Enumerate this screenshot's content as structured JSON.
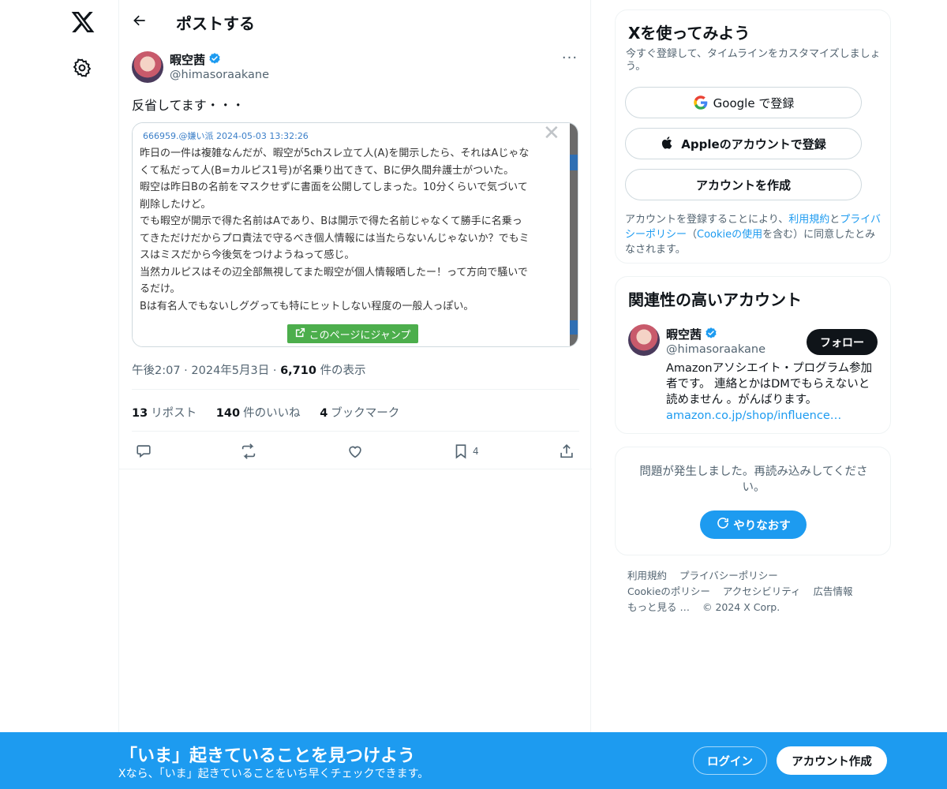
{
  "header": {
    "title": "ポストする"
  },
  "post": {
    "author_name": "暇空茜",
    "author_handle": "@himasoraakane",
    "text": "反省してます・・・",
    "embed": {
      "meta": "666959.@嫌い派 2024-05-03 13:32:26",
      "close_glyph": "✕",
      "lines": [
        "昨日の一件は複雑なんだが、暇空が5chスレ立て人(A)を開示したら、それはAじゃな",
        "くて私だって人(B=カルピス1号)が名乗り出てきて、Bに伊久間弁護士がついた。",
        "暇空は昨日Bの名前をマスクせずに書面を公開してしまった。10分くらいで気づいて",
        "削除したけど。",
        "でも暇空が開示で得た名前はAであり、Bは開示で得た名前じゃなくて勝手に名乗っ",
        "てきただけだからプロ責法で守るべき個人情報には当たらないんじゃないか？でもミ",
        "スはミスだから今後気をつけようねって感じ。",
        "当然カルピスはその辺全部無視してまた暇空が個人情報晒したー！って方向で騒いで",
        "るだけ。",
        "Bは有名人でもないしググっても特にヒットしない程度の一般人っぽい。"
      ],
      "jump_label": "このページにジャンプ"
    },
    "time": "午後2:07",
    "date": "2024年5月3日",
    "separator": "·",
    "views": "6,710",
    "views_label": "件の表示",
    "reposts": "13",
    "reposts_label": "リポスト",
    "likes": "140",
    "likes_label": "件のいいね",
    "bookmarks": "4",
    "bookmarks_label": "ブックマーク",
    "bookmark_action_count": "4"
  },
  "signup": {
    "title": "Xを使ってみよう",
    "desc": "今すぐ登録して、タイムラインをカスタマイズしましょう。",
    "google_label": "Google で登録",
    "apple_label": "Appleのアカウントで登録",
    "create_label": "アカウントを作成",
    "terms_prefix": "アカウントを登録することにより、",
    "terms_link1": "利用規約",
    "terms_and": "と",
    "terms_link2": "プライバシーポリシー",
    "terms_paren_open": "（",
    "terms_link3": "Cookieの使用",
    "terms_suffix": "を含む）に同意したとみなされます。"
  },
  "related": {
    "title": "関連性の高いアカウント",
    "name": "暇空茜",
    "handle": "@himasoraakane",
    "follow_label": "フォロー",
    "bio": "Amazonアソシエイト・プログラム参加者です。 連絡とかはDMでもらえないと読めません 。がんばりま",
    "bio_tail": "す。",
    "bio_link": "amazon.co.jp/shop/influence…"
  },
  "error": {
    "text": "問題が発生しました。再読み込みしてください。",
    "retry_label": "やりなおす"
  },
  "footer": {
    "links": [
      "利用規約",
      "プライバシーポリシー",
      "Cookieのポリシー",
      "アクセシビリティ",
      "広告情報",
      "もっと見る …",
      "© 2024 X Corp."
    ]
  },
  "banner": {
    "title": "「いま」起きていることを見つけよう",
    "sub": "Xなら、「いま」起きていることをいち早くチェックできます。",
    "login_label": "ログイン",
    "create_label": "アカウント作成"
  },
  "colors": {
    "accent": "#1d9bf0",
    "text": "#0f1419",
    "muted": "#536471",
    "jump_green": "#4cae4c"
  },
  "icons": [
    "x-logo-icon",
    "gear-icon",
    "back-arrow-icon",
    "verified-icon",
    "more-icon",
    "reply-icon",
    "repost-icon",
    "like-icon",
    "bookmark-icon",
    "share-icon",
    "google-icon",
    "apple-icon",
    "refresh-icon",
    "external-link-icon"
  ]
}
